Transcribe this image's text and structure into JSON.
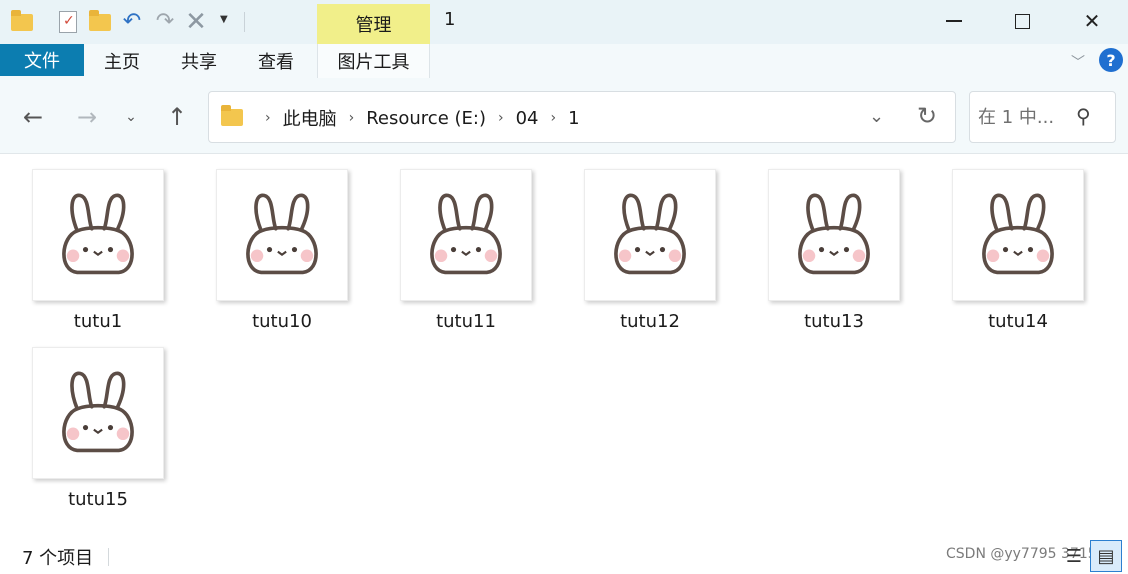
{
  "title_bar": {
    "context_tab": "管理",
    "window_title": "1",
    "quick_access_icons": [
      "folder-icon",
      "properties-icon",
      "new-folder-icon",
      "undo-icon",
      "redo-icon",
      "delete-icon",
      "customize-dropdown-icon"
    ],
    "window_controls": [
      "minimize-icon",
      "maximize-icon",
      "close-icon"
    ]
  },
  "ribbon": {
    "file_tab": "文件",
    "tabs": [
      "主页",
      "共享",
      "查看"
    ],
    "picture_tools_tab": "图片工具",
    "help_glyph": "?"
  },
  "navigation": {
    "breadcrumb": [
      "此电脑",
      "Resource (E:)",
      "04",
      "1"
    ],
    "search_placeholder": "在 1 中..."
  },
  "files": [
    {
      "name": "tutu1"
    },
    {
      "name": "tutu10"
    },
    {
      "name": "tutu11"
    },
    {
      "name": "tutu12"
    },
    {
      "name": "tutu13"
    },
    {
      "name": "tutu14"
    },
    {
      "name": "tutu15"
    }
  ],
  "status_bar": {
    "item_count": "7 个项目",
    "watermark": "CSDN @yy7795 3715"
  },
  "colors": {
    "file_tab": "#0c7db0",
    "context_tab": "#f1ef8a",
    "title_background": "#e9f3f7",
    "folder": "#f3c64e"
  }
}
